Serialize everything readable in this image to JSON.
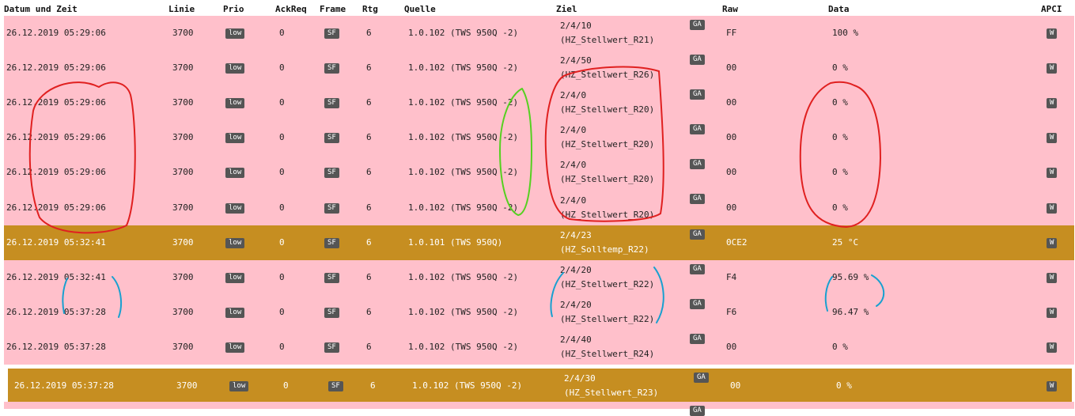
{
  "columns": {
    "datum": "Datum und Zeit",
    "linie": "Linie",
    "prio": "Prio",
    "ackreq": "AckReq",
    "frame": "Frame",
    "rtg": "Rtg",
    "quelle": "Quelle",
    "ziel": "Ziel",
    "raw": "Raw",
    "data": "Data",
    "apci": "APCI"
  },
  "colors": {
    "pink_row": "#ffc0cb",
    "gold_row": "#c68e21",
    "badge": "#555555"
  },
  "rows": [
    {
      "style": "pink",
      "datum": "26.12.2019 05:29:06",
      "linie": "3700",
      "prio": "low",
      "ackreq": "0",
      "frame": "SF",
      "rtg": "6",
      "quelle": "1.0.102 (TWS 950Q -2)",
      "ziel_addr": "2/4/10",
      "ziel_name": "(HZ_Stellwert_R21)",
      "ga": "GA",
      "raw": "FF",
      "data": "100 %",
      "apci": "W"
    },
    {
      "style": "pink",
      "datum": "26.12.2019 05:29:06",
      "linie": "3700",
      "prio": "low",
      "ackreq": "0",
      "frame": "SF",
      "rtg": "6",
      "quelle": "1.0.102 (TWS 950Q -2)",
      "ziel_addr": "2/4/50",
      "ziel_name": "(HZ_Stellwert_R26)",
      "ga": "GA",
      "raw": "00",
      "data": "0 %",
      "apci": "W"
    },
    {
      "style": "pink",
      "datum": "26.12.2019 05:29:06",
      "linie": "3700",
      "prio": "low",
      "ackreq": "0",
      "frame": "SF",
      "rtg": "6",
      "quelle": "1.0.102 (TWS 950Q -2)",
      "ziel_addr": "2/4/0",
      "ziel_name": "(HZ_Stellwert_R20)",
      "ga": "GA",
      "raw": "00",
      "data": "0 %",
      "apci": "W"
    },
    {
      "style": "pink",
      "datum": "26.12.2019 05:29:06",
      "linie": "3700",
      "prio": "low",
      "ackreq": "0",
      "frame": "SF",
      "rtg": "6",
      "quelle": "1.0.102 (TWS 950Q -2)",
      "ziel_addr": "2/4/0",
      "ziel_name": "(HZ_Stellwert_R20)",
      "ga": "GA",
      "raw": "00",
      "data": "0 %",
      "apci": "W"
    },
    {
      "style": "pink",
      "datum": "26.12.2019 05:29:06",
      "linie": "3700",
      "prio": "low",
      "ackreq": "0",
      "frame": "SF",
      "rtg": "6",
      "quelle": "1.0.102 (TWS 950Q -2)",
      "ziel_addr": "2/4/0",
      "ziel_name": "(HZ_Stellwert_R20)",
      "ga": "GA",
      "raw": "00",
      "data": "0 %",
      "apci": "W"
    },
    {
      "style": "pink",
      "datum": "26.12.2019 05:29:06",
      "linie": "3700",
      "prio": "low",
      "ackreq": "0",
      "frame": "SF",
      "rtg": "6",
      "quelle": "1.0.102 (TWS 950Q -2)",
      "ziel_addr": "2/4/0",
      "ziel_name": "(HZ_Stellwert_R20)",
      "ga": "GA",
      "raw": "00",
      "data": "0 %",
      "apci": "W"
    },
    {
      "style": "gold",
      "datum": "26.12.2019 05:32:41",
      "linie": "3700",
      "prio": "low",
      "ackreq": "0",
      "frame": "SF",
      "rtg": "6",
      "quelle": "1.0.101 (TWS 950Q)",
      "ziel_addr": "2/4/23",
      "ziel_name": "(HZ_Solltemp_R22)",
      "ga": "GA",
      "raw": "0CE2",
      "data": "25 °C",
      "apci": "W"
    },
    {
      "style": "pink",
      "datum": "26.12.2019 05:32:41",
      "linie": "3700",
      "prio": "low",
      "ackreq": "0",
      "frame": "SF",
      "rtg": "6",
      "quelle": "1.0.102 (TWS 950Q -2)",
      "ziel_addr": "2/4/20",
      "ziel_name": "(HZ_Stellwert_R22)",
      "ga": "GA",
      "raw": "F4",
      "data": "95.69 %",
      "apci": "W"
    },
    {
      "style": "pink",
      "datum": "26.12.2019 05:37:28",
      "linie": "3700",
      "prio": "low",
      "ackreq": "0",
      "frame": "SF",
      "rtg": "6",
      "quelle": "1.0.102 (TWS 950Q -2)",
      "ziel_addr": "2/4/20",
      "ziel_name": "(HZ_Stellwert_R22)",
      "ga": "GA",
      "raw": "F6",
      "data": "96.47 %",
      "apci": "W"
    },
    {
      "style": "pink",
      "datum": "26.12.2019 05:37:28",
      "linie": "3700",
      "prio": "low",
      "ackreq": "0",
      "frame": "SF",
      "rtg": "6",
      "quelle": "1.0.102 (TWS 950Q -2)",
      "ziel_addr": "2/4/40",
      "ziel_name": "(HZ_Stellwert_R24)",
      "ga": "GA",
      "raw": "00",
      "data": "0 %",
      "apci": "W"
    },
    {
      "style": "gold",
      "datum": "26.12.2019 05:37:28",
      "linie": "3700",
      "prio": "low",
      "ackreq": "0",
      "frame": "SF",
      "rtg": "6",
      "quelle": "1.0.102 (TWS 950Q -2)",
      "ziel_addr": "2/4/30",
      "ziel_name": "(HZ_Stellwert_R23)",
      "ga": "GA",
      "raw": "00",
      "data": "0 %",
      "apci": "W"
    }
  ],
  "partial_row": {
    "ga": "GA"
  }
}
